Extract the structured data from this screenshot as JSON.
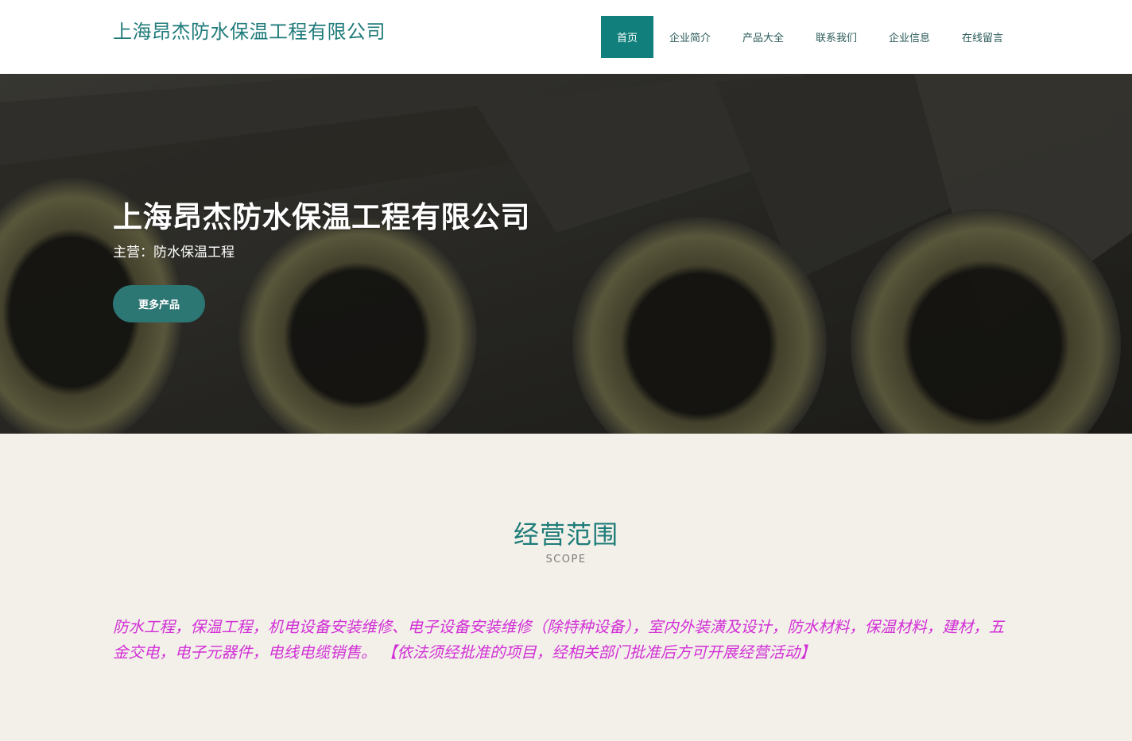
{
  "header": {
    "logo_text": "上海昂杰防水保温工程有限公司",
    "nav": [
      {
        "label": "首页",
        "active": true
      },
      {
        "label": "企业简介",
        "active": false
      },
      {
        "label": "产品大全",
        "active": false
      },
      {
        "label": "联系我们",
        "active": false
      },
      {
        "label": "企业信息",
        "active": false
      },
      {
        "label": "在线留言",
        "active": false
      }
    ]
  },
  "hero": {
    "title": "上海昂杰防水保温工程有限公司",
    "subtitle": "主营：防水保温工程",
    "button_label": "更多产品"
  },
  "scope": {
    "title": "经营范围",
    "subtitle": "SCOPE",
    "text": "防水工程，保温工程，机电设备安装维修、电子设备安装维修（除特种设备），室内外装潢及设计，防水材料，保温材料，建材，五金交电，电子元器件，电线电缆销售。 【依法须经批准的项目，经相关部门批准后方可开展经营活动】"
  },
  "colors": {
    "accent": "#117f7b",
    "scope_text": "#d22fd6",
    "section_bg": "#f3f0e9"
  }
}
